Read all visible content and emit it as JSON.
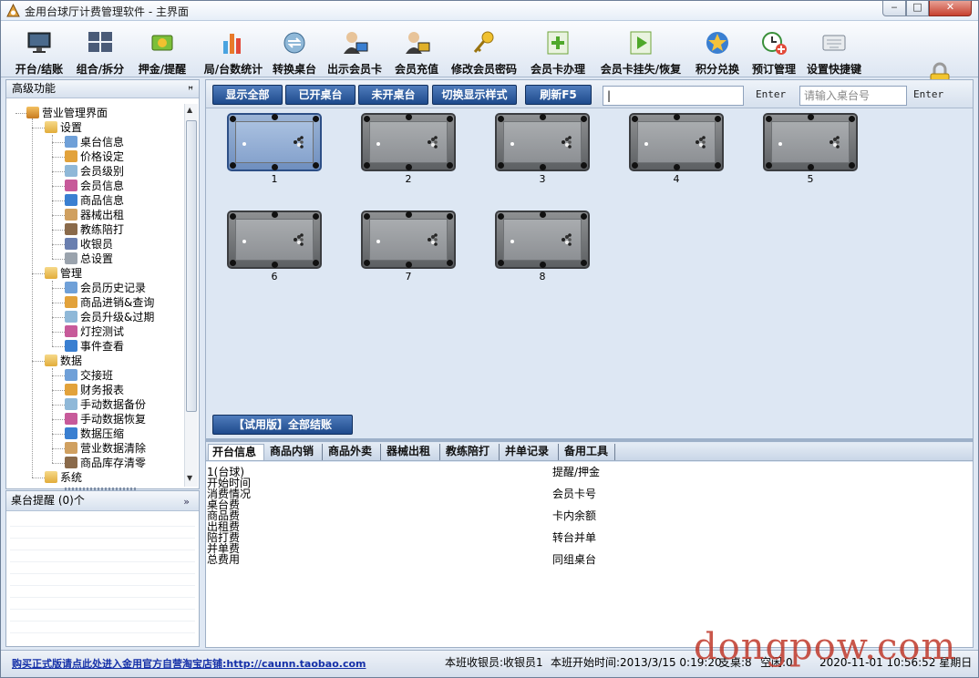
{
  "window": {
    "title": "金用台球厅计费管理软件 - 主界面",
    "min": "‒",
    "max": "□",
    "close": "✕"
  },
  "toolbar": {
    "items": [
      {
        "label": "开台/结账",
        "icon": "monitor-icon"
      },
      {
        "label": "组合/拆分",
        "icon": "grid-icon"
      },
      {
        "label": "押金/提醒",
        "icon": "money-icon"
      },
      {
        "label": "局/台数统计",
        "icon": "bar-chart-icon"
      },
      {
        "label": "转换桌台",
        "icon": "swap-icon"
      },
      {
        "label": "出示会员卡",
        "icon": "member-card-icon"
      },
      {
        "label": "会员充值",
        "icon": "member-recharge-icon"
      },
      {
        "label": "修改会员密码",
        "icon": "key-icon"
      },
      {
        "label": "会员卡办理",
        "icon": "add-icon"
      },
      {
        "label": "会员卡挂失/恢复",
        "icon": "play-icon"
      },
      {
        "label": "积分兑换",
        "icon": "star-icon"
      },
      {
        "label": "预订管理",
        "icon": "clock-add-icon"
      },
      {
        "label": "设置快捷键",
        "icon": "keyboard-icon"
      }
    ]
  },
  "left_panel": {
    "title": "高级功能",
    "pin": "ꟸ",
    "tree": {
      "root": "营业管理界面",
      "groups": [
        {
          "label": "设置",
          "items": [
            "桌台信息",
            "价格设定",
            "会员级别",
            "会员信息",
            "商品信息",
            "器械出租",
            "教练陪打",
            "收银员",
            "总设置"
          ]
        },
        {
          "label": "管理",
          "items": [
            "会员历史记录",
            "商品进销&查询",
            "会员升级&过期",
            "灯控测试",
            "事件查看"
          ]
        },
        {
          "label": "数据",
          "items": [
            "交接班",
            "财务报表",
            "手动数据备份",
            "手动数据恢复",
            "数据压缩",
            "营业数据清除",
            "商品库存清零"
          ]
        },
        {
          "label": "系统",
          "items": []
        }
      ]
    }
  },
  "reminder": {
    "title": "桌台提醒 (0)个",
    "arrow": "»"
  },
  "filters": {
    "buttons": [
      "显示全部",
      "已开桌台",
      "未开桌台",
      "切换显示样式",
      "刷新F5"
    ],
    "search1_value": "|",
    "enter_label": "Enter",
    "search2_placeholder": "请输入桌台号"
  },
  "tables": [
    {
      "num": "1",
      "state": "selected"
    },
    {
      "num": "2",
      "state": "idle"
    },
    {
      "num": "3",
      "state": "idle"
    },
    {
      "num": "4",
      "state": "idle"
    },
    {
      "num": "5",
      "state": "idle"
    },
    {
      "num": "6",
      "state": "idle"
    },
    {
      "num": "7",
      "state": "idle"
    },
    {
      "num": "8",
      "state": "idle"
    }
  ],
  "trial_button": "【试用版】全部结账",
  "tabs": [
    "开台信息",
    "商品内销",
    "商品外卖",
    "器械出租",
    "教练陪打",
    "并单记录",
    "备用工具"
  ],
  "info": {
    "left": [
      "1(台球)",
      "开始时间",
      "消费情况",
      "桌台费",
      "商品费",
      "出租费",
      "陪打费",
      "并单费",
      "总费用"
    ],
    "right": [
      "提醒/押金",
      "会员卡号",
      "卡内余额",
      "转台并单",
      "同组桌台"
    ]
  },
  "status": {
    "link": "购买正式版请点此处进入金用官方自营淘宝店铺:http://caunn.taobao.com",
    "cashier": "本班收银员:收银员1",
    "start": "本班开始时间:2013/3/15 0:19:20",
    "occupied": "支桌:8",
    "idle": "空闲:0",
    "clock": "2020-11-01 10:56:52 星期日"
  },
  "watermark": "dongpow.com"
}
